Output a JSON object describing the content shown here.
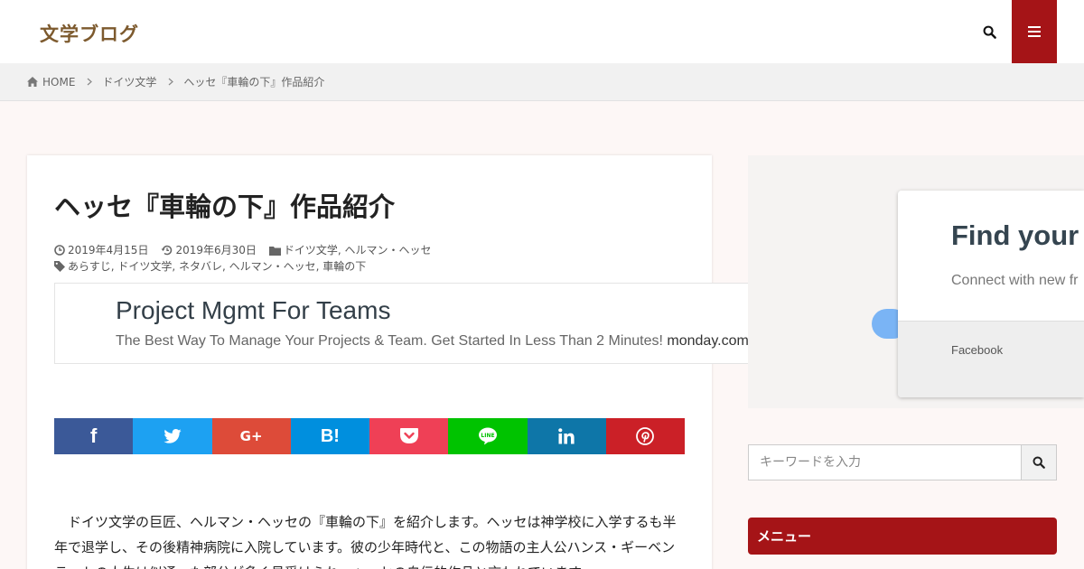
{
  "header": {
    "logo": "文学ブログ"
  },
  "breadcrumb": {
    "home": "HOME",
    "category": "ドイツ文学",
    "current": "ヘッセ『車輪の下』作品紹介"
  },
  "article": {
    "title": "ヘッセ『車輪の下』作品紹介",
    "published": "2019年4月15日",
    "updated": "2019年6月30日",
    "categories": "ドイツ文学, ヘルマン・ヘッセ",
    "tags": "あらすじ, ドイツ文学, ネタバレ, ヘルマン・ヘッセ, 車輪の下",
    "body": "ドイツ文学の巨匠、ヘルマン・ヘッセの『車輪の下』を紹介します。ヘッセは神学校に入学するも半年で退学し、その後精神病院に入院しています。彼の少年時代と、この物語の主人公ハンス・ギーベンラートの人生は似通った部分が多く見受けられ、ヘッセの自伝的作品と言われています。"
  },
  "ad": {
    "title": "Project Mgmt For Teams",
    "description": "The Best Way To Manage Your Projects & Team. Get Started In Less Than 2 Minutes!",
    "domain": "monday.com"
  },
  "share": {
    "facebook": "f",
    "gplus": "G+",
    "hatena": "B!",
    "colors": {
      "facebook": "#3b5998",
      "twitter": "#1da1f2",
      "gplus": "#dd4b39",
      "hatena": "#008fde",
      "pocket": "#ef4056",
      "line": "#00c300",
      "linkedin": "#0e76a8",
      "pinterest": "#cb2027"
    }
  },
  "sidebar": {
    "fb_ad": {
      "title": "Find your c",
      "subtitle": "Connect with new fr",
      "footer": "Facebook"
    },
    "search_placeholder": "キーワードを入力",
    "menu_title": "メニュー"
  },
  "colors": {
    "accent": "#a51417",
    "logo": "#7d5a2e"
  }
}
